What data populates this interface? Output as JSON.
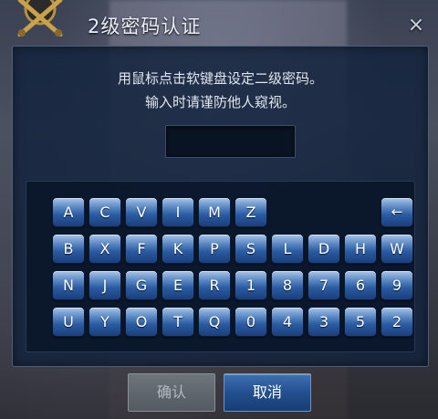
{
  "dialog": {
    "title": "2级密码认证",
    "close_icon": "close-icon",
    "close_glyph": "×"
  },
  "instructions": {
    "line1": "用鼠标点击软键盘设定二级密码。",
    "line2": "输入时请谨防他人窥视。"
  },
  "password": {
    "value": ""
  },
  "keyboard": {
    "row1": [
      "A",
      "C",
      "V",
      "I",
      "M",
      "Z"
    ],
    "backspace": "←",
    "row2": [
      "B",
      "X",
      "F",
      "K",
      "P",
      "S",
      "L",
      "D",
      "H",
      "W"
    ],
    "row3": [
      "N",
      "J",
      "G",
      "E",
      "R",
      "1",
      "8",
      "7",
      "6",
      "9"
    ],
    "row4": [
      "U",
      "Y",
      "O",
      "T",
      "Q",
      "0",
      "4",
      "3",
      "5",
      "2"
    ]
  },
  "buttons": {
    "confirm": "确认",
    "cancel": "取消"
  },
  "colors": {
    "panel": "#14243e",
    "key": "#2a5aa0",
    "confirm_disabled": "#5d636b",
    "cancel": "#23508f"
  }
}
